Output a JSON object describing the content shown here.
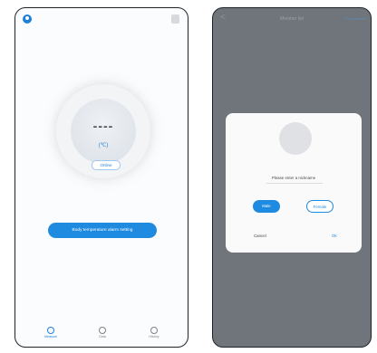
{
  "left_screen": {
    "gauge": {
      "value": "----",
      "unit": "(℃)"
    },
    "status_pill": "Online",
    "alarm_button": "Body temperature alarm setting",
    "tabs": [
      {
        "label": "Measure",
        "icon": "gauge-icon",
        "active": true
      },
      {
        "label": "Data",
        "icon": "data-icon",
        "active": false
      },
      {
        "label": "History",
        "icon": "clock-icon",
        "active": false
      }
    ]
  },
  "right_screen": {
    "header": {
      "back": "<",
      "title": "Member list",
      "action": "Add member"
    },
    "dialog": {
      "prompt": "Please enter a nickname",
      "male": "Male",
      "female": "Female",
      "cancel": "Cancel",
      "ok": "Ok"
    }
  },
  "colors": {
    "accent": "#1e8ae0",
    "overlay": "#6f757b"
  }
}
